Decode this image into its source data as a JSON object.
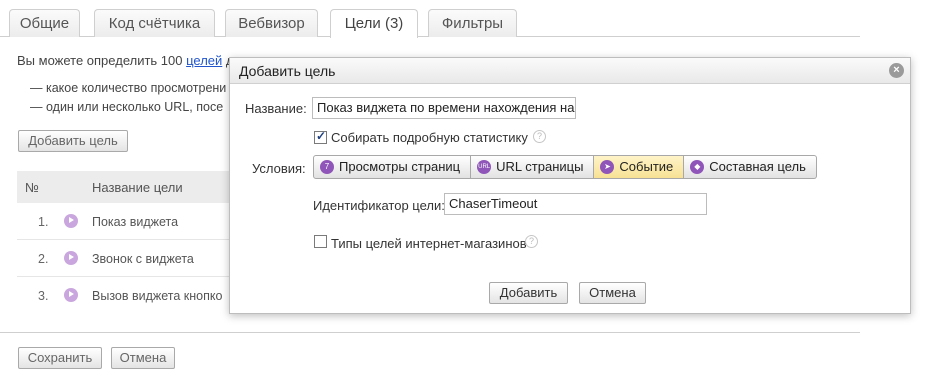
{
  "tabs": [
    "Общие",
    "Код счётчика",
    "Вебвизор",
    "Цели (3)",
    "Фильтры"
  ],
  "intro": {
    "prefix": "Вы можете определить 100 ",
    "link": "целей",
    "suffix": " д"
  },
  "bullets": [
    "— какое количество просмотрени",
    "— один или несколько URL, посе"
  ],
  "add_goal_button": "Добавить цель",
  "table": {
    "col_num": "№",
    "col_name": "Название цели",
    "rows": [
      {
        "num": "1.",
        "name": "Показ виджета"
      },
      {
        "num": "2.",
        "name": "Звонок с виджета"
      },
      {
        "num": "3.",
        "name": "Вызов виджета кнопко"
      }
    ]
  },
  "footer": {
    "save": "Сохранить",
    "cancel": "Отмена"
  },
  "dialog": {
    "title": "Добавить цель",
    "close_glyph": "×",
    "name_label": "Название:",
    "name_value": "Показ виджета по времени нахождения на",
    "detailed_stats_label": "Собирать подробную статистику",
    "detailed_stats_checked": true,
    "conditions_label": "Условия:",
    "condition_types": [
      {
        "label": "Просмотры страниц",
        "icon": "page-views-icon",
        "glyph": "7"
      },
      {
        "label": "URL страницы",
        "icon": "url-icon",
        "glyph": "URL"
      },
      {
        "label": "Событие",
        "icon": "event-icon",
        "glyph": "➤",
        "active": true
      },
      {
        "label": "Составная цель",
        "icon": "composite-goal-icon",
        "glyph": "◆"
      }
    ],
    "goal_id_label": "Идентификатор цели:",
    "goal_id_value": "ChaserTimeout",
    "ecommerce_label": "Типы целей интернет-магазинов",
    "ecommerce_checked": false,
    "help_glyph": "?",
    "add_button": "Добавить",
    "cancel_button": "Отмена"
  },
  "colors": {
    "link": "#2255cc",
    "active_segment": "#f7e194",
    "goal_icon": "#8f55b8"
  }
}
